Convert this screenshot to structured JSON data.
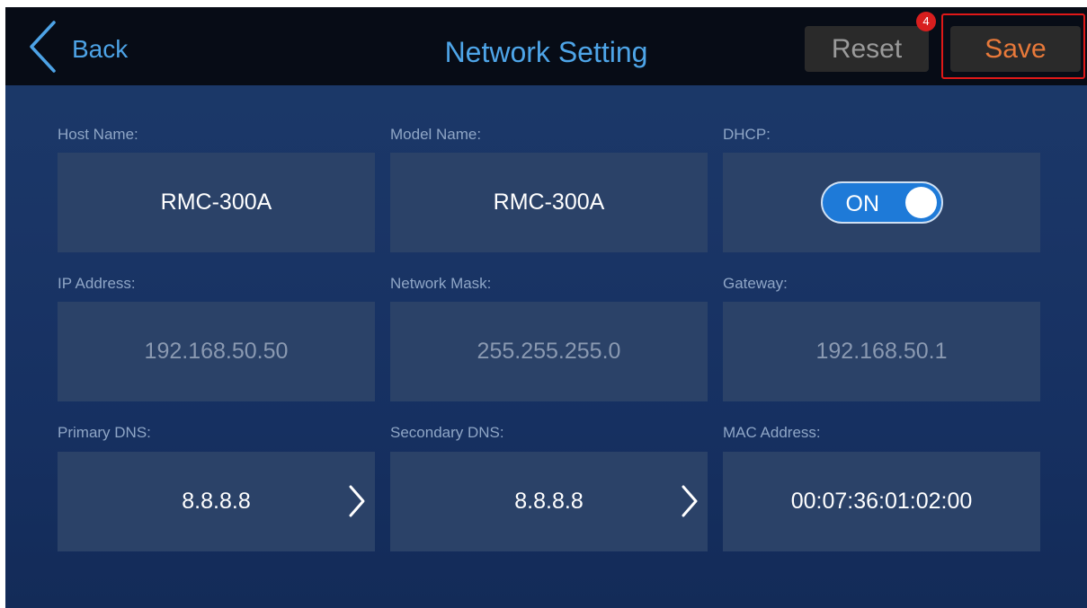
{
  "header": {
    "back_label": "Back",
    "title": "Network Setting",
    "reset_label": "Reset",
    "save_label": "Save",
    "badge_count": "4"
  },
  "fields": {
    "host_name": {
      "label": "Host Name:",
      "value": "RMC-300A"
    },
    "model_name": {
      "label": "Model Name:",
      "value": "RMC-300A"
    },
    "dhcp": {
      "label": "DHCP:",
      "value": "ON"
    },
    "ip_address": {
      "label": "IP Address:",
      "value": "192.168.50.50"
    },
    "network_mask": {
      "label": "Network Mask:",
      "value": "255.255.255.0"
    },
    "gateway": {
      "label": "Gateway:",
      "value": "192.168.50.1"
    },
    "primary_dns": {
      "label": "Primary DNS:",
      "value": "8.8.8.8"
    },
    "secondary_dns": {
      "label": "Secondary DNS:",
      "value": "8.8.8.8"
    },
    "mac_address": {
      "label": "MAC Address:",
      "value": "00:07:36:01:02:00"
    }
  },
  "colors": {
    "accent_blue": "#4ea5e8",
    "save_orange": "#e8793a",
    "highlight_red": "#e01818",
    "toggle_on": "#1e7ad8"
  },
  "icons": [
    "chevron-left-icon",
    "chevron-right-icon"
  ]
}
